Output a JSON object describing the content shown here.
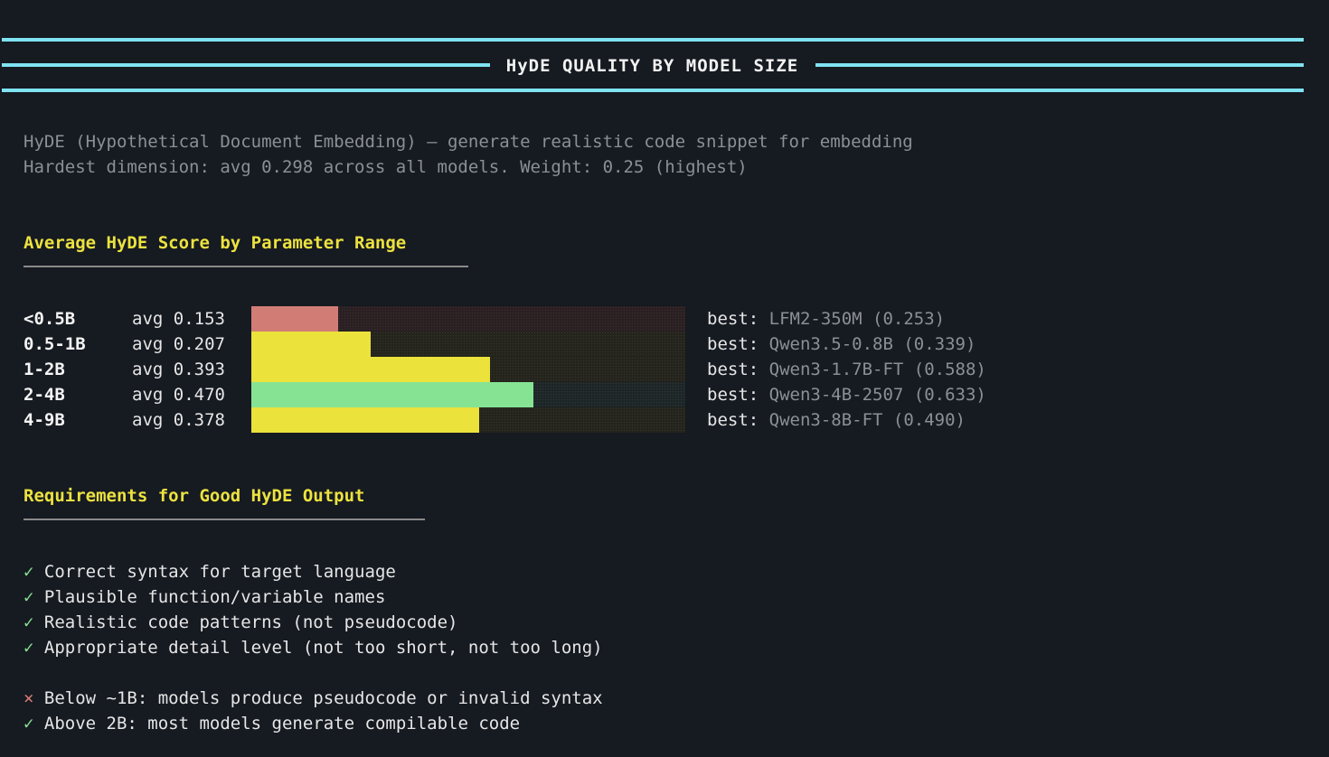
{
  "banner": {
    "title": "HyDE QUALITY BY MODEL SIZE"
  },
  "description": {
    "line1": "HyDE (Hypothetical Document Embedding) — generate realistic code snippet for embedding",
    "line2": "Hardest dimension: avg 0.298 across all models. Weight: 0.25 (highest)"
  },
  "score_section": {
    "title": "Average HyDE Score by Parameter Range",
    "best_label": "best:",
    "rows": [
      {
        "range": "<0.5B",
        "avg_text": "avg 0.153",
        "avg": 0.153,
        "fill": 0.2,
        "color": "#d17d76",
        "track_tint": "#2a1f22",
        "best": "LFM2-350M (0.253)"
      },
      {
        "range": "0.5-1B",
        "avg_text": "avg 0.207",
        "avg": 0.207,
        "fill": 0.275,
        "color": "#ebe23c",
        "track_tint": "#24241c",
        "best": "Qwen3.5-0.8B (0.339)"
      },
      {
        "range": "1-2B",
        "avg_text": "avg 0.393",
        "avg": 0.393,
        "fill": 0.55,
        "color": "#ebe23c",
        "track_tint": "#24241c",
        "best": "Qwen3-1.7B-FT (0.588)"
      },
      {
        "range": "2-4B",
        "avg_text": "avg 0.470",
        "avg": 0.47,
        "fill": 0.65,
        "color": "#86e394",
        "track_tint": "#1d2627",
        "best": "Qwen3-4B-2507 (0.633)"
      },
      {
        "range": "4-9B",
        "avg_text": "avg 0.378",
        "avg": 0.378,
        "fill": 0.525,
        "color": "#ebe23c",
        "track_tint": "#24241c",
        "best": "Qwen3-8B-FT (0.490)"
      }
    ]
  },
  "requirements_section": {
    "title": "Requirements for Good HyDE Output",
    "items": [
      {
        "mark": "✓",
        "ok": true,
        "text": "Correct syntax for target language"
      },
      {
        "mark": "✓",
        "ok": true,
        "text": "Plausible function/variable names"
      },
      {
        "mark": "✓",
        "ok": true,
        "text": "Realistic code patterns (not pseudocode)"
      },
      {
        "mark": "✓",
        "ok": true,
        "text": "Appropriate detail level (not too short, not too long)"
      }
    ],
    "notes": [
      {
        "mark": "×",
        "ok": false,
        "text": "Below ~1B: models produce pseudocode or invalid syntax"
      },
      {
        "mark": "✓",
        "ok": true,
        "text": "Above 2B: most models generate compilable code"
      }
    ]
  },
  "colors": {
    "accent_cyan": "#7fe3f2",
    "heading_yellow": "#ece23f",
    "good_green": "#86e394",
    "bad_red": "#d97e79"
  }
}
